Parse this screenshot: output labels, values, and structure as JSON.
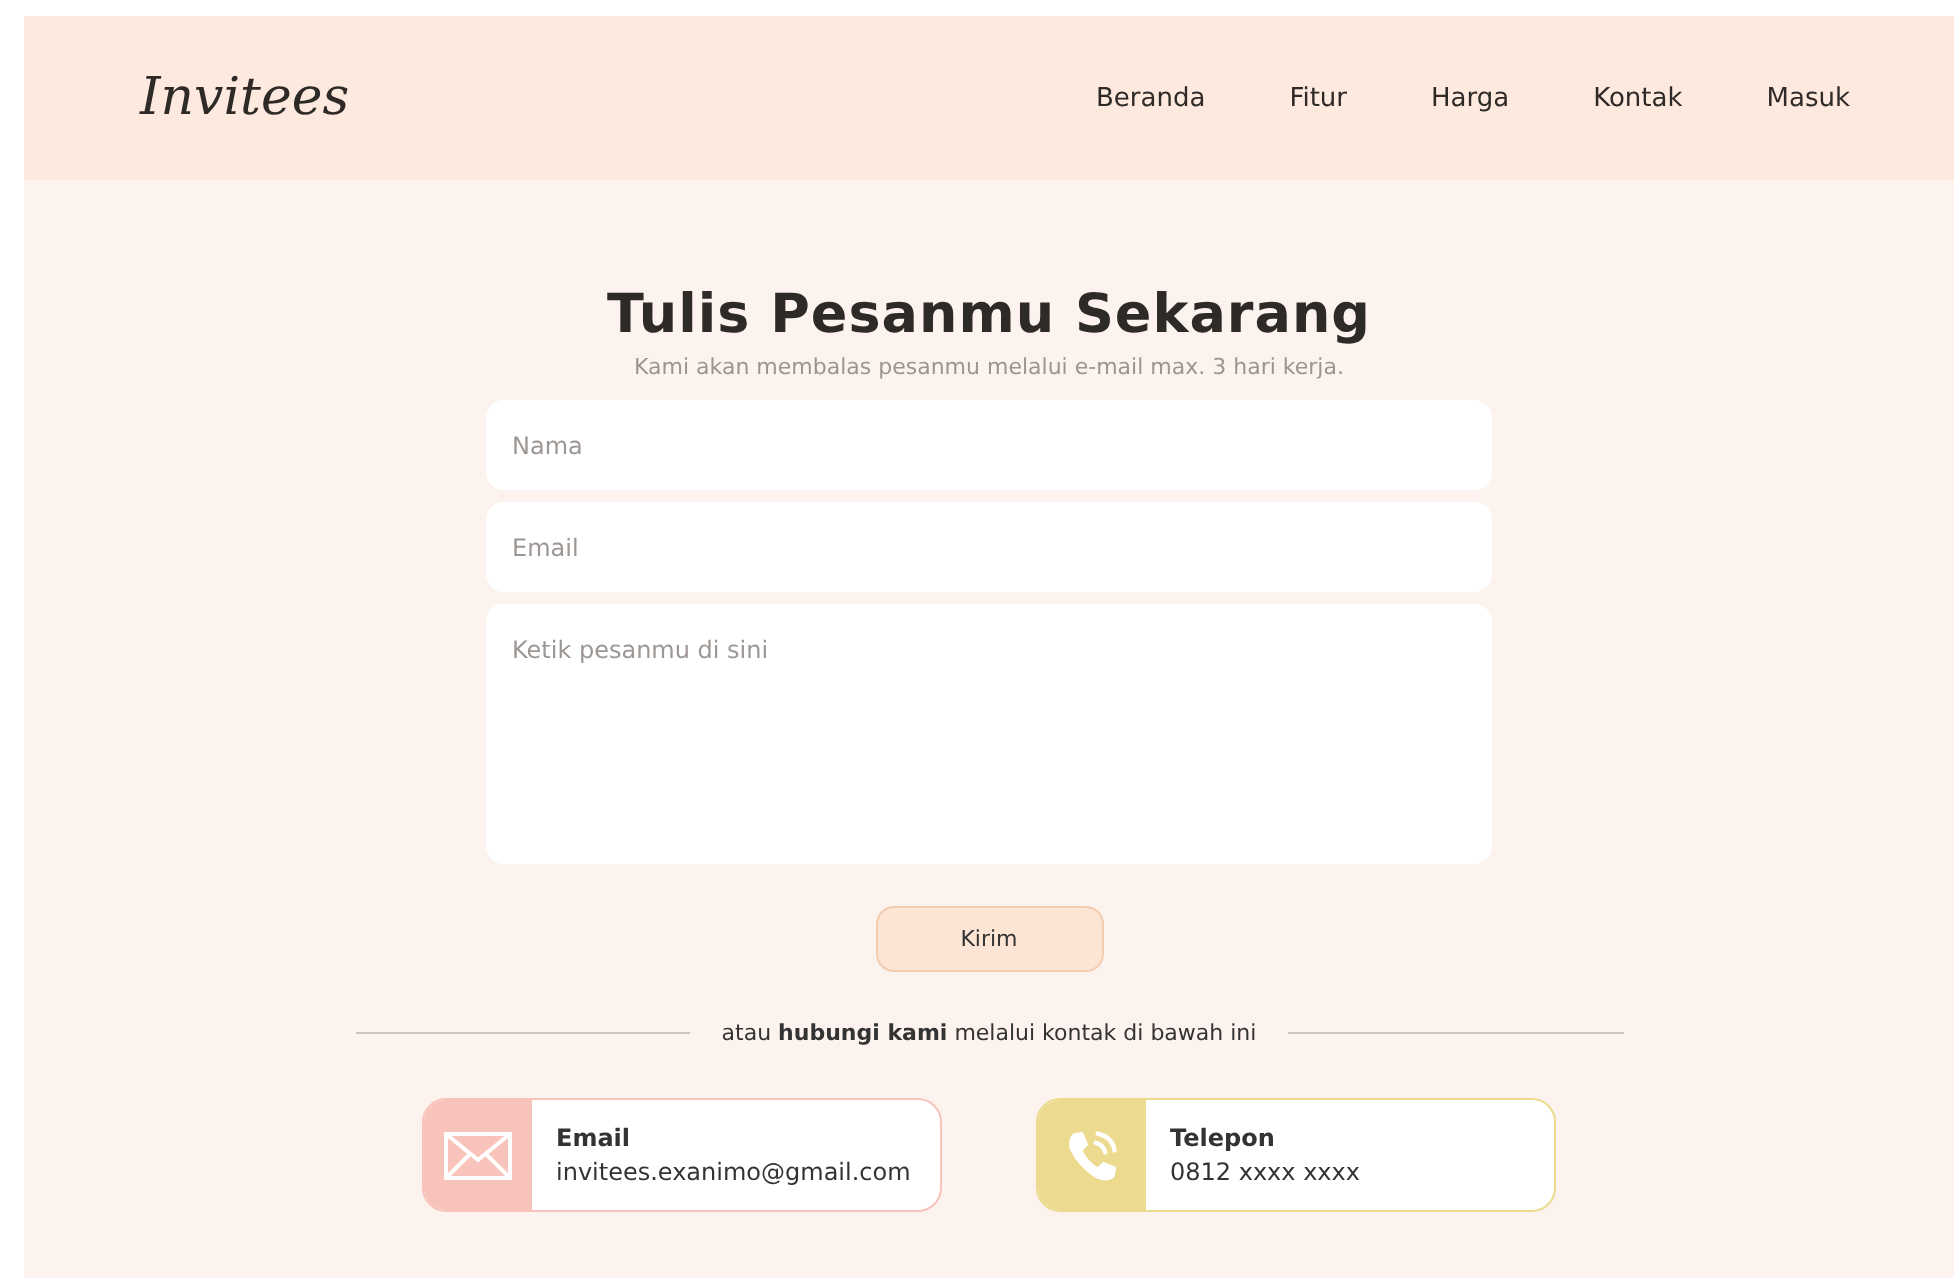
{
  "header": {
    "logo": "Invitees",
    "nav": [
      {
        "label": "Beranda"
      },
      {
        "label": "Fitur"
      },
      {
        "label": "Harga"
      },
      {
        "label": "Kontak"
      },
      {
        "label": "Masuk"
      }
    ]
  },
  "form": {
    "title": "Tulis Pesanmu Sekarang",
    "subtitle": "Kami akan membalas pesanmu melalui e-mail max. 3 hari kerja.",
    "fields": [
      {
        "kind": "input",
        "placeholder": "Nama"
      },
      {
        "kind": "input",
        "placeholder": "Email"
      },
      {
        "kind": "textarea",
        "placeholder": "Ketik pesanmu di sini"
      }
    ],
    "submit": "Kirim"
  },
  "divider_text": "atau **hubungi kami** melalui kontak di bawah ini",
  "contacts": [
    {
      "kind": "email",
      "color": "#f8c3bb",
      "label": "Email",
      "value": "invitees.exanimo@gmail.com"
    },
    {
      "kind": "phone",
      "color": "#ecdb8e",
      "label": "Telepon",
      "value": "0812 xxxx xxxx"
    }
  ]
}
